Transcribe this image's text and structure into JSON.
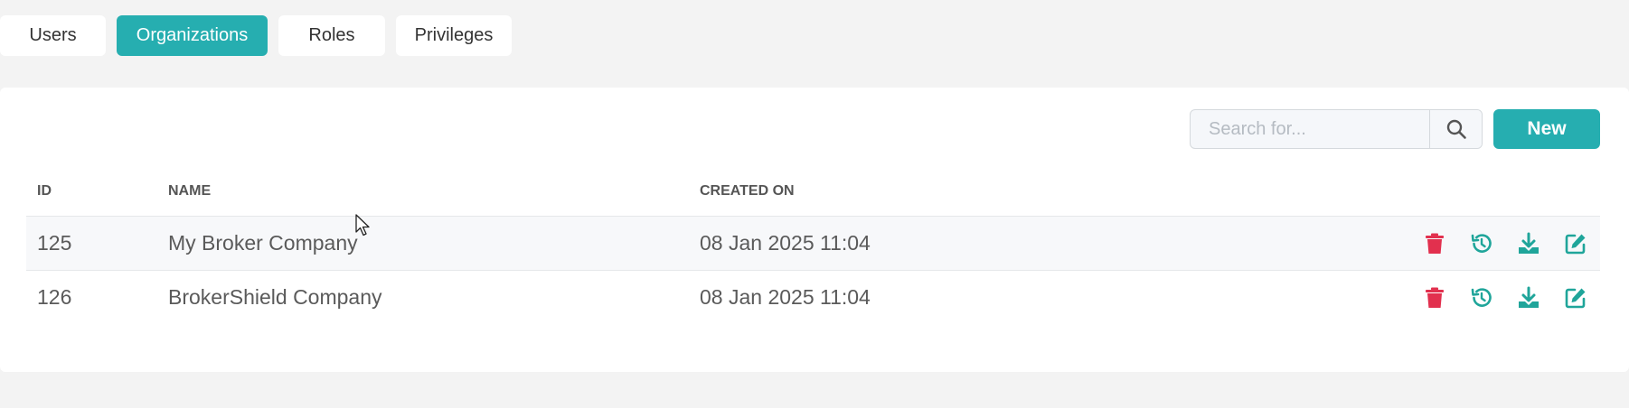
{
  "tabs": [
    {
      "label": "Users",
      "active": false
    },
    {
      "label": "Organizations",
      "active": true
    },
    {
      "label": "Roles",
      "active": false
    },
    {
      "label": "Privileges",
      "active": false
    }
  ],
  "toolbar": {
    "search_placeholder": "Search for...",
    "search_value": "",
    "new_label": "New"
  },
  "table": {
    "columns": [
      "ID",
      "NAME",
      "CREATED ON"
    ],
    "rows": [
      {
        "id": "125",
        "name": "My Broker Company",
        "created_on": "08 Jan 2025 11:04"
      },
      {
        "id": "126",
        "name": "BrokerShield Company",
        "created_on": "08 Jan 2025 11:04"
      }
    ],
    "row_actions": [
      "trash-icon",
      "history-icon",
      "download-icon",
      "edit-icon"
    ]
  },
  "colors": {
    "accent": "#26aeb0",
    "delete": "#e2304e",
    "action": "#1fa59a",
    "background": "#f3f3f3"
  }
}
